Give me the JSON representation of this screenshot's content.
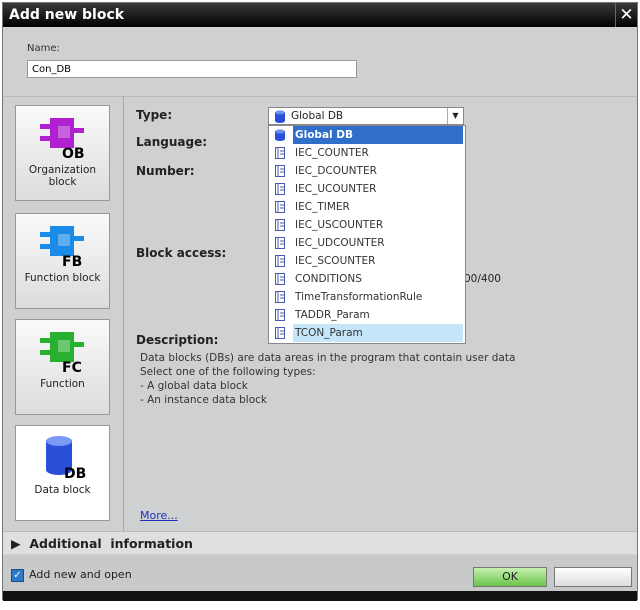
{
  "window": {
    "title": "Add new block",
    "close_icon": "close-icon"
  },
  "name": {
    "label": "Name:",
    "value": "Con_DB"
  },
  "blocks": [
    {
      "label": "Organization block",
      "code": "OB",
      "color": "#b020d0",
      "selected": false
    },
    {
      "label": "Function block",
      "code": "FB",
      "color": "#1a8ce8",
      "selected": false
    },
    {
      "label": "Function",
      "code": "FC",
      "color": "#2ab030",
      "selected": false
    },
    {
      "label": "Data block",
      "code": "DB",
      "color": "#2a4fd8",
      "selected": true
    }
  ],
  "form": {
    "type_label": "Type:",
    "language_label": "Language:",
    "number_label": "Number:",
    "block_access_label": "Block access:",
    "description_label": "Description:",
    "block_access_value_partial": "00/400"
  },
  "type_dropdown": {
    "selected": "Global DB",
    "options": [
      "Global DB",
      "IEC_COUNTER",
      "IEC_DCOUNTER",
      "IEC_UCOUNTER",
      "IEC_TIMER",
      "IEC_USCOUNTER",
      "IEC_UDCOUNTER",
      "IEC_SCOUNTER",
      "CONDITIONS",
      "TimeTransformationRule",
      "TADDR_Param",
      "TCON_Param"
    ],
    "highlighted": "Global DB",
    "hovered": "TCON_Param"
  },
  "description": [
    "Data blocks (DBs) are data areas in the program that contain user data",
    "Select one of the following types:",
    "- A global data block",
    "- An instance data block"
  ],
  "more_link": "More...",
  "additional_info": "Additional  information",
  "footer": {
    "add_new_and_open": "Add new and open",
    "checked": true,
    "ok": "OK",
    "cancel": ""
  }
}
